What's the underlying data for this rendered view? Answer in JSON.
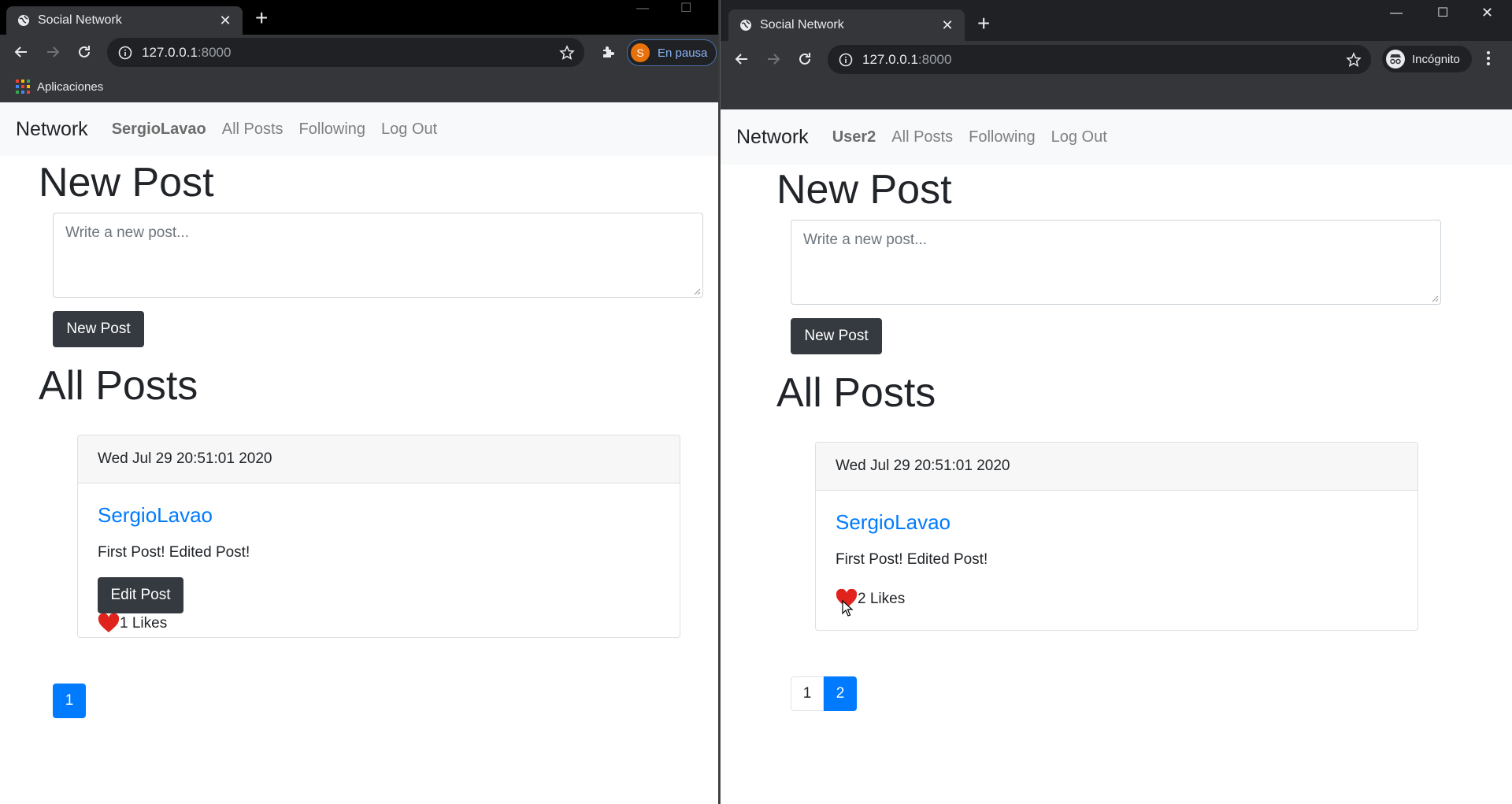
{
  "left": {
    "tab_title": "Social Network",
    "url_host": "127.0.0.1",
    "url_port": ":8000",
    "profile_initial": "S",
    "profile_status": "En pausa",
    "bookmarks_label": "Aplicaciones",
    "nav": {
      "brand": "Network",
      "user": "SergioLavao",
      "all_posts": "All Posts",
      "following": "Following",
      "logout": "Log Out"
    },
    "new_post_heading": "New Post",
    "textarea_placeholder": "Write a new post...",
    "new_post_button": "New Post",
    "all_posts_heading": "All Posts",
    "post": {
      "timestamp": "Wed Jul 29 20:51:01 2020",
      "author": "SergioLavao",
      "content": "First Post! Edited Post!",
      "edit_button": "Edit Post",
      "likes": "1 Likes"
    },
    "pages": [
      "1"
    ],
    "active_page": "1"
  },
  "right": {
    "tab_title": "Social Network",
    "url_host": "127.0.0.1",
    "url_port": ":8000",
    "incognito_label": "Incógnito",
    "nav": {
      "brand": "Network",
      "user": "User2",
      "all_posts": "All Posts",
      "following": "Following",
      "logout": "Log Out"
    },
    "new_post_heading": "New Post",
    "textarea_placeholder": "Write a new post...",
    "new_post_button": "New Post",
    "all_posts_heading": "All Posts",
    "post": {
      "timestamp": "Wed Jul 29 20:51:01 2020",
      "author": "SergioLavao",
      "content": "First Post! Edited Post!",
      "likes": "2 Likes"
    },
    "pages": [
      "1",
      "2"
    ],
    "active_page": "2"
  },
  "colors": {
    "link_blue": "#007bff",
    "dark_button": "#343a40",
    "heart_red": "#e0231c",
    "profile_orange": "#e8710a"
  }
}
